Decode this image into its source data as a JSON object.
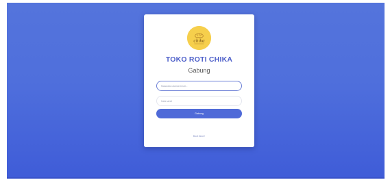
{
  "app": {
    "logo_text": "chika",
    "store_name": "TOKO ROTI CHIKA",
    "form_title": "Gabung"
  },
  "form": {
    "email_placeholder": "Masukkan alamat email...",
    "password_placeholder": "Kata sandi",
    "submit_label": "Gabung",
    "register_link": "Buat Akun!"
  },
  "colors": {
    "background": "#4f6fdc",
    "accent": "#4f6ad8",
    "logo": "#f6cf4c"
  }
}
